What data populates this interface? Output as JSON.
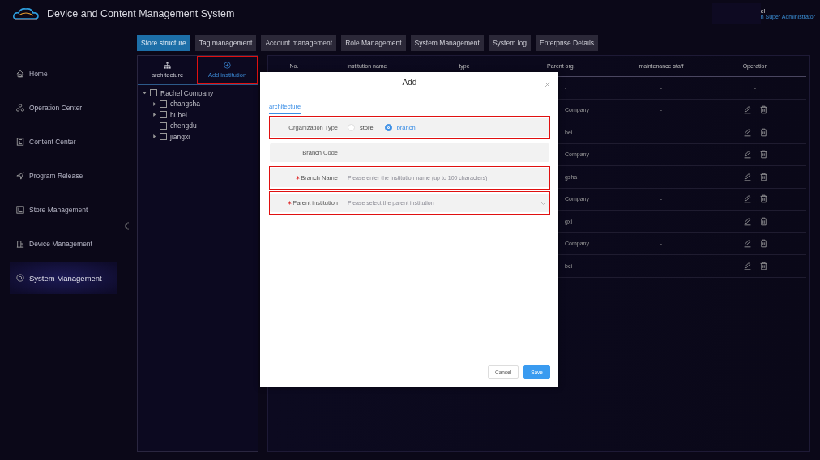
{
  "header": {
    "title": "Device and Content Management System",
    "user": {
      "name": "el",
      "role": "n Super Administrator"
    }
  },
  "sidebar": {
    "items": [
      {
        "label": "Home",
        "selected": false
      },
      {
        "label": "Operation Center",
        "selected": false
      },
      {
        "label": "Content Center",
        "selected": false
      },
      {
        "label": "Program Release",
        "selected": false
      },
      {
        "label": "Store Management",
        "selected": false
      },
      {
        "label": "Device Management",
        "selected": false
      },
      {
        "label": "System Management",
        "selected": true
      }
    ]
  },
  "tabs": [
    {
      "label": "Store structure",
      "selected": true
    },
    {
      "label": "Tag management",
      "selected": false
    },
    {
      "label": "Account management",
      "selected": false
    },
    {
      "label": "Role Management",
      "selected": false
    },
    {
      "label": "System Management",
      "selected": false
    },
    {
      "label": "System log",
      "selected": false
    },
    {
      "label": "Enterprise Details",
      "selected": false
    }
  ],
  "tree_panel": {
    "buttons": [
      {
        "label": "architecture",
        "selected": false,
        "highlighted": false
      },
      {
        "label": "Add institution",
        "selected": true,
        "highlighted": true
      }
    ],
    "nodes": [
      {
        "label": "Rachel Company",
        "checked": false,
        "expanded": true,
        "children": [
          {
            "label": "changsha",
            "checked": false,
            "expanded": false
          },
          {
            "label": "hubei",
            "checked": false,
            "expanded": false
          },
          {
            "label": "chengdu",
            "checked": false
          },
          {
            "label": "jiangxi",
            "checked": false,
            "expanded": false
          }
        ]
      }
    ]
  },
  "table": {
    "columns": [
      "No.",
      "institution name",
      "type",
      "Parent org.",
      "maintenance staff",
      "Operation"
    ],
    "rows": [
      {
        "parent_org": "-",
        "staff": "-",
        "operation": "-"
      },
      {
        "parent_org": "Company",
        "staff": "-"
      },
      {
        "parent_org": "bei"
      },
      {
        "parent_org": "Company",
        "staff": "-"
      },
      {
        "parent_org": "gsha"
      },
      {
        "parent_org": "Company",
        "staff": "-"
      },
      {
        "parent_org": "gxi"
      },
      {
        "parent_org": "Company",
        "staff": "-"
      },
      {
        "parent_org": "bei"
      }
    ]
  },
  "modal": {
    "title": "Add",
    "tab": "architecture",
    "fields": [
      {
        "kind": "radio",
        "label": "Organization Type",
        "required": false,
        "highlighted": true,
        "options": [
          {
            "label": "store",
            "selected": false
          },
          {
            "label": "branch",
            "selected": true
          }
        ]
      },
      {
        "kind": "static",
        "label": "Branch Code",
        "required": false,
        "highlighted": false
      },
      {
        "kind": "input",
        "label": "Branch Name",
        "required": true,
        "highlighted": true,
        "placeholder": "Please enter the institution name (up to 100 characters)"
      },
      {
        "kind": "select",
        "label": "Parent institution",
        "required": true,
        "highlighted": true,
        "placeholder": "Please select the parent institution"
      }
    ],
    "buttons": [
      {
        "label": "Cancel",
        "kind": "secondary"
      },
      {
        "label": "Save",
        "kind": "primary"
      }
    ]
  }
}
